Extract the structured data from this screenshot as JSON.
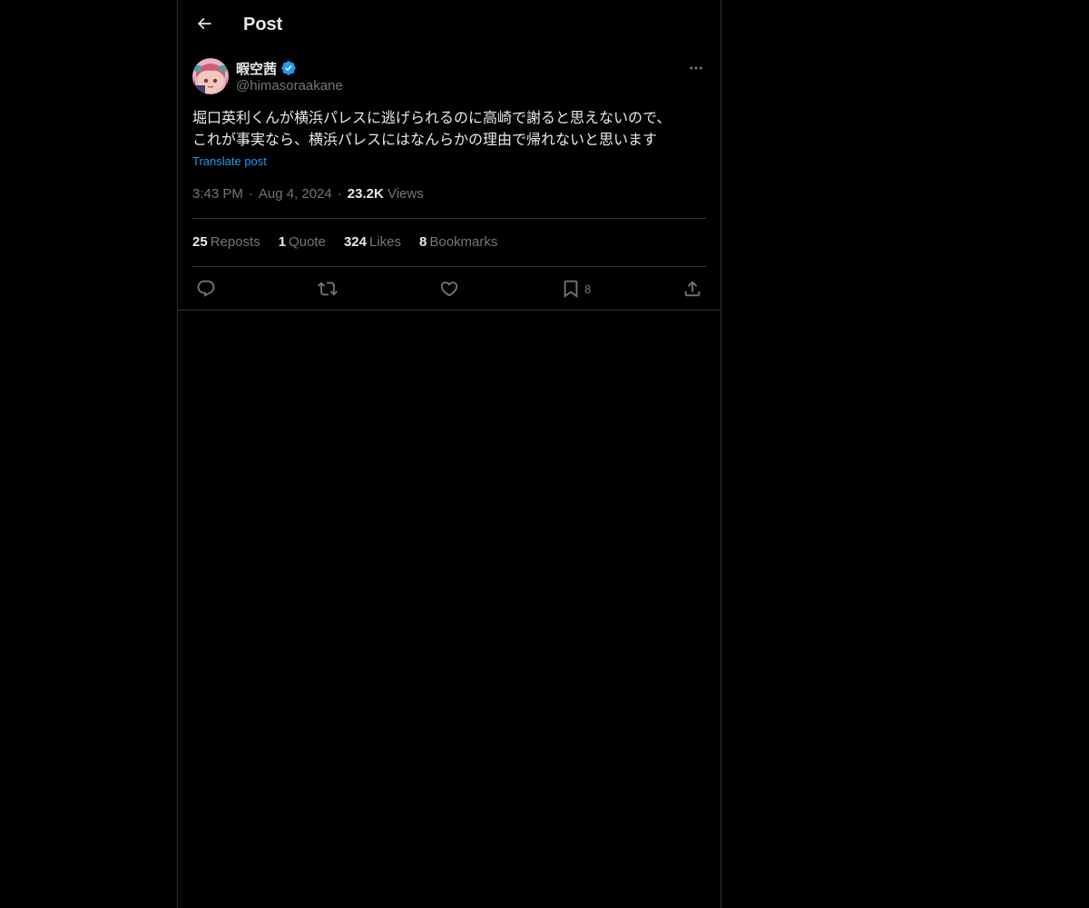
{
  "header": {
    "title": "Post"
  },
  "colors": {
    "background": "#000000",
    "text_primary": "#e7e9ea",
    "text_secondary": "#71767b",
    "accent": "#1d9bf0",
    "border": "#2f3336"
  },
  "post": {
    "author": {
      "display_name": "暇空茜",
      "handle": "@himasoraakane",
      "verified": true,
      "avatar_icon": "avatar-image"
    },
    "text_lines": [
      "堀口英利くんが横浜パレスに逃げられるのに高崎で謝ると思えないので、",
      "これが事実なら、横浜パレスにはなんらかの理由で帰れないと思います"
    ],
    "translate_label": "Translate post",
    "time": "3:43 PM",
    "date": "Aug 4, 2024",
    "views_count": "23.2K",
    "views_label": "Views",
    "stats": {
      "reposts": {
        "count": "25",
        "label": "Reposts"
      },
      "quotes": {
        "count": "1",
        "label": "Quote"
      },
      "likes": {
        "count": "324",
        "label": "Likes"
      },
      "bookmarks": {
        "count": "8",
        "label": "Bookmarks"
      }
    },
    "actions": {
      "reply_icon": "reply-icon",
      "repost_icon": "repost-icon",
      "like_icon": "like-icon",
      "bookmark_icon": "bookmark-icon",
      "bookmark_count": "8",
      "share_icon": "share-icon"
    }
  }
}
